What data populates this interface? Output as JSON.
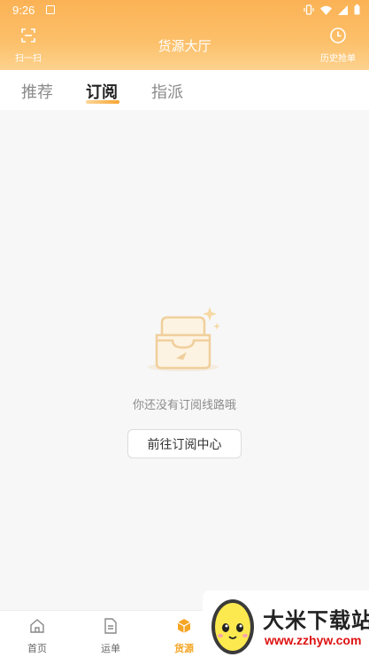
{
  "status_bar": {
    "time": "9:26"
  },
  "header": {
    "title": "货源大厅",
    "scan_label": "扫一扫",
    "history_label": "历史抢单"
  },
  "tabs": [
    {
      "label": "推荐",
      "active": false
    },
    {
      "label": "订阅",
      "active": true
    },
    {
      "label": "指派",
      "active": false
    }
  ],
  "empty_state": {
    "message": "你还没有订阅线路哦",
    "button_label": "前往订阅中心"
  },
  "bottom_nav": [
    {
      "label": "首页",
      "icon": "home-icon",
      "active": false
    },
    {
      "label": "运单",
      "icon": "document-icon",
      "active": false
    },
    {
      "label": "货源",
      "icon": "box-icon",
      "active": true
    }
  ],
  "watermark": {
    "title": "大米下载站",
    "url": "www.zzhyw.com"
  },
  "colors": {
    "accent": "#f5a524",
    "header_gradient_top": "#fbb255",
    "header_gradient_bottom": "#fdd28e",
    "watermark_url": "#dd1111"
  }
}
